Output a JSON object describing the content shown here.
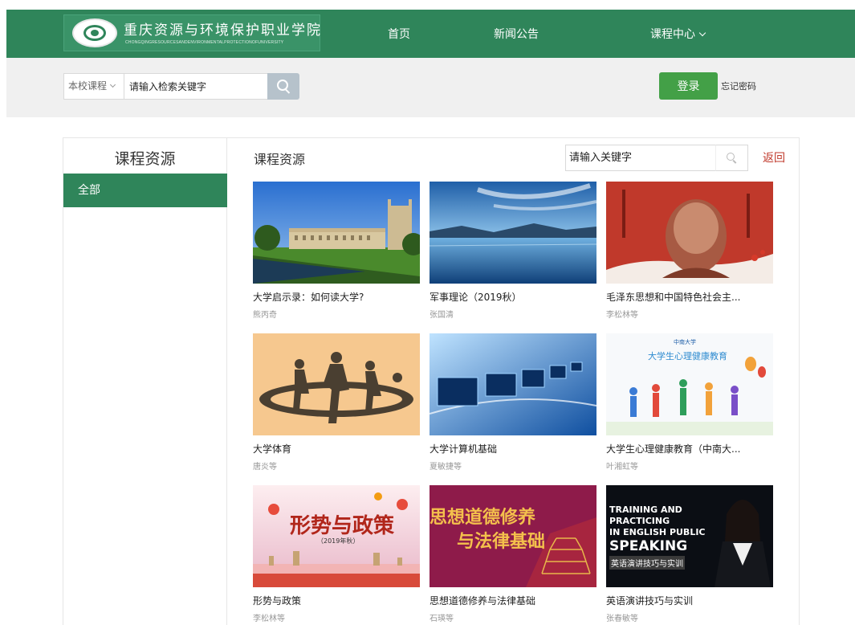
{
  "school": {
    "name": "重庆资源与环境保护职业学院",
    "name_en": "CHONGQINGRESOURCESANDENVIRONMENTALPROTECTIONOFUNIVERSITY"
  },
  "nav": {
    "home": "首页",
    "news": "新闻公告",
    "courses": "课程中心"
  },
  "search": {
    "scope": "本校课程",
    "placeholder": "请输入检索关键字"
  },
  "auth": {
    "login": "登录",
    "forgot": "忘记密码"
  },
  "sidebar": {
    "title": "课程资源",
    "items": [
      {
        "label": "全部"
      }
    ]
  },
  "content": {
    "title": "课程资源",
    "keyword_placeholder": "请输入关键字",
    "back": "返回"
  },
  "courses": [
    {
      "title": "大学启示录：如何读大学?",
      "teacher": "熊丙奇",
      "thumb": "college-building-photo"
    },
    {
      "title": "军事理论（2019秋）",
      "teacher": "张国清",
      "thumb": "lake-mountain-photo"
    },
    {
      "title": "毛泽东思想和中国特色社会主...",
      "teacher": "李松林等",
      "thumb": "red-statue-photo"
    },
    {
      "title": "大学体育",
      "teacher": "唐炎等",
      "thumb": "sports-silhouette-art"
    },
    {
      "title": "大学计算机基础",
      "teacher": "夏敏捷等",
      "thumb": "blue-laptops-art"
    },
    {
      "title": "大学生心理健康教育（中南大...",
      "teacher": "叶湘虹等",
      "thumb": "happy-students-art",
      "thumb_text": [
        "大学生心理健康教育",
        "中南大学"
      ]
    },
    {
      "title": "形势与政策",
      "teacher": "李松林等",
      "thumb": "lanterns-art",
      "thumb_text": [
        "形势与政策",
        "（2019年秋）"
      ]
    },
    {
      "title": "思想道德修养与法律基础",
      "teacher": "石瑛等",
      "thumb": "pavilion-art",
      "thumb_text": [
        "思想道德修养",
        "与法律基础"
      ]
    },
    {
      "title": "英语演讲技巧与实训",
      "teacher": "张春敏等",
      "thumb": "speaker-photo",
      "thumb_text": [
        "TRAINING AND",
        "PRACTICING",
        "IN ENGLISH PUBLIC",
        "SPEAKING",
        "英语演讲技巧与实训"
      ]
    }
  ]
}
